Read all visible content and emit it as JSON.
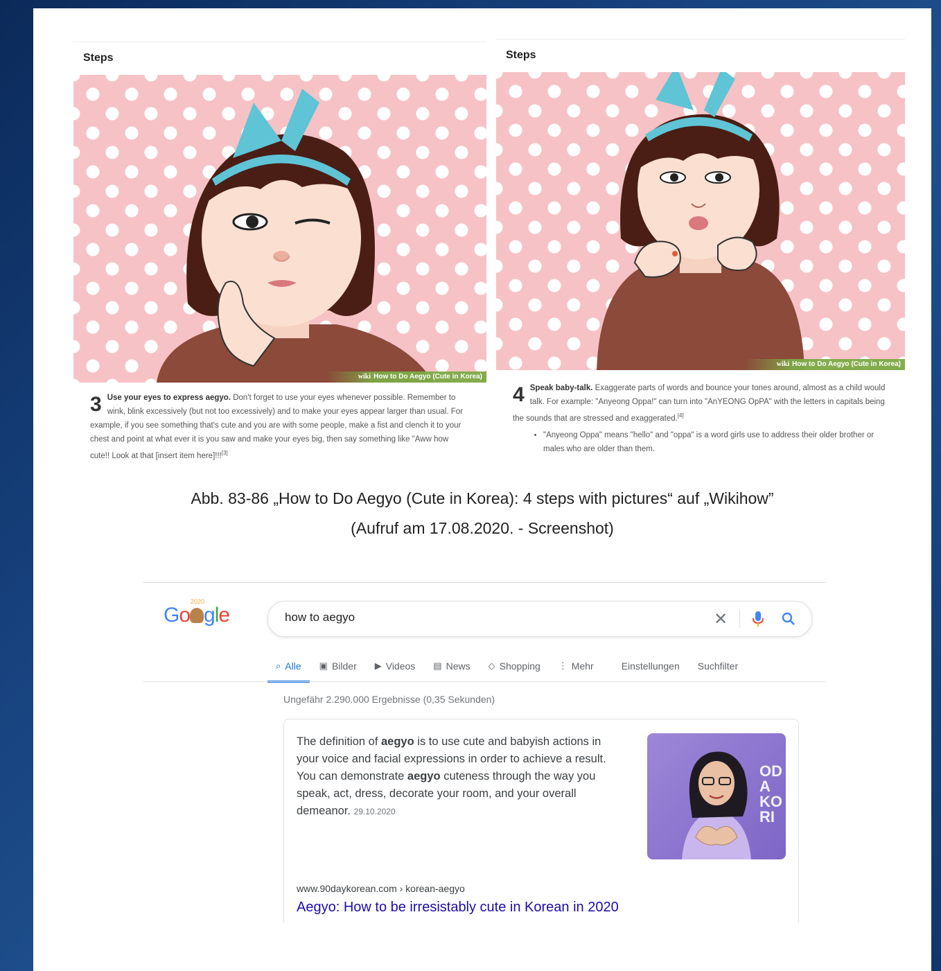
{
  "left_panel": {
    "header": "Steps",
    "watermark_prefix": "wiki",
    "watermark": "How to Do Aegyo (Cute in Korea)",
    "step_number": "3",
    "step_lead": "Use your eyes to express aegyo.",
    "step_text": "Don't forget to use your eyes whenever possible. Remember to wink, blink excessively (but not too excessively) and to make your eyes appear larger than usual. For example, if you see something that's cute and you are with some people, make a fist and clench it to your chest and point at what ever it is you saw and make your eyes big, then say something like \"Aww how cute!! Look at that [insert item here]!!!",
    "ref": "[3]"
  },
  "right_panel": {
    "header": "Steps",
    "watermark_prefix": "wiki",
    "watermark": "How to Do Aegyo (Cute in Korea)",
    "step_number": "4",
    "step_lead": "Speak baby-talk.",
    "step_text": "Exaggerate parts of words and bounce your tones around, almost as a child would talk. For example: \"Anyeong Oppa!\" can turn into \"AnYEONG OpPA\" with the letters in capitals being the sounds that are stressed and exaggerated.",
    "ref": "[4]",
    "bullet": "\"Anyeong Oppa\" means \"hello\" and \"oppa\" is a word girls use to address their older brother or males who are older than them."
  },
  "caption": {
    "line1": "Abb. 83-86 „How to Do Aegyo (Cute in Korea): 4 steps with pictures“ auf „Wikihow”",
    "line2": "(Aufruf am 17.08.2020. - Screenshot)"
  },
  "google": {
    "logo": "Google",
    "doodle_year": "2020",
    "query": "how to aegyo",
    "tabs": [
      {
        "label": "Alle",
        "icon": "🔍",
        "active": true
      },
      {
        "label": "Bilder",
        "icon": "▣"
      },
      {
        "label": "Videos",
        "icon": "▶"
      },
      {
        "label": "News",
        "icon": "▤"
      },
      {
        "label": "Shopping",
        "icon": "◇"
      },
      {
        "label": "Mehr",
        "icon": "⋮"
      },
      {
        "label": "Einstellungen",
        "icon": ""
      },
      {
        "label": "Suchfilter",
        "icon": ""
      }
    ],
    "stats": "Ungefähr 2.290.000 Ergebnisse (0,35 Sekunden)",
    "snippet": {
      "t1": "The definition of ",
      "b1": "aegyo",
      "t2": " is to use cute and babyish actions in your voice and facial expressions in order to achieve a result. You can demonstrate ",
      "b2": "aegyo",
      "t3": " cuteness through the way you speak, act, dress, decorate your room, and your overall demeanor.",
      "date": "29.10.2020",
      "thumb_text": "ODA KORI"
    },
    "result": {
      "url": "www.90daykorean.com › korean-aegyo",
      "title": "Aegyo: How to be irresistably cute in Korean in 2020"
    },
    "colors": {
      "link": "#1a0dab",
      "accent": "#1a73e8",
      "mic": "#4285f4"
    }
  }
}
